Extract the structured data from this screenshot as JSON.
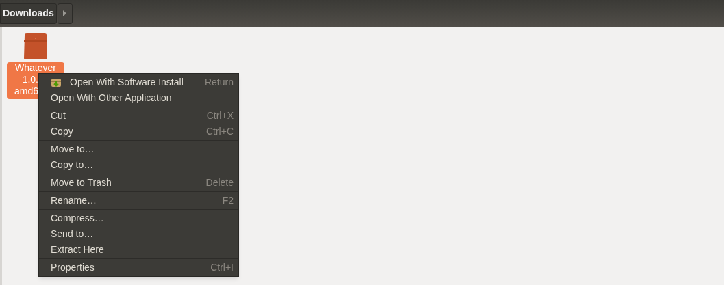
{
  "path_bar": {
    "current": "Downloads"
  },
  "file": {
    "name_lines": [
      "Whatever",
      "1.0.",
      "amd6"
    ],
    "selected": true
  },
  "context_menu": {
    "groups": [
      [
        {
          "label": "Open With Software Install",
          "shortcut": "Return",
          "kind": "app"
        },
        {
          "label": "Open With Other Application",
          "kind": "plain"
        }
      ],
      [
        {
          "label": "Cut",
          "shortcut": "Ctrl+X",
          "kind": "plain"
        },
        {
          "label": "Copy",
          "shortcut": "Ctrl+C",
          "kind": "plain"
        }
      ],
      [
        {
          "label": "Move to…",
          "kind": "plain"
        },
        {
          "label": "Copy to…",
          "kind": "plain"
        }
      ],
      [
        {
          "label": "Move to Trash",
          "shortcut": "Delete",
          "kind": "plain"
        }
      ],
      [
        {
          "label": "Rename…",
          "shortcut": "F2",
          "kind": "plain"
        }
      ],
      [
        {
          "label": "Compress…",
          "kind": "plain"
        },
        {
          "label": "Send to…",
          "kind": "plain"
        },
        {
          "label": "Extract Here",
          "kind": "plain"
        }
      ],
      [
        {
          "label": "Properties",
          "shortcut": "Ctrl+I",
          "kind": "plain"
        }
      ]
    ]
  }
}
